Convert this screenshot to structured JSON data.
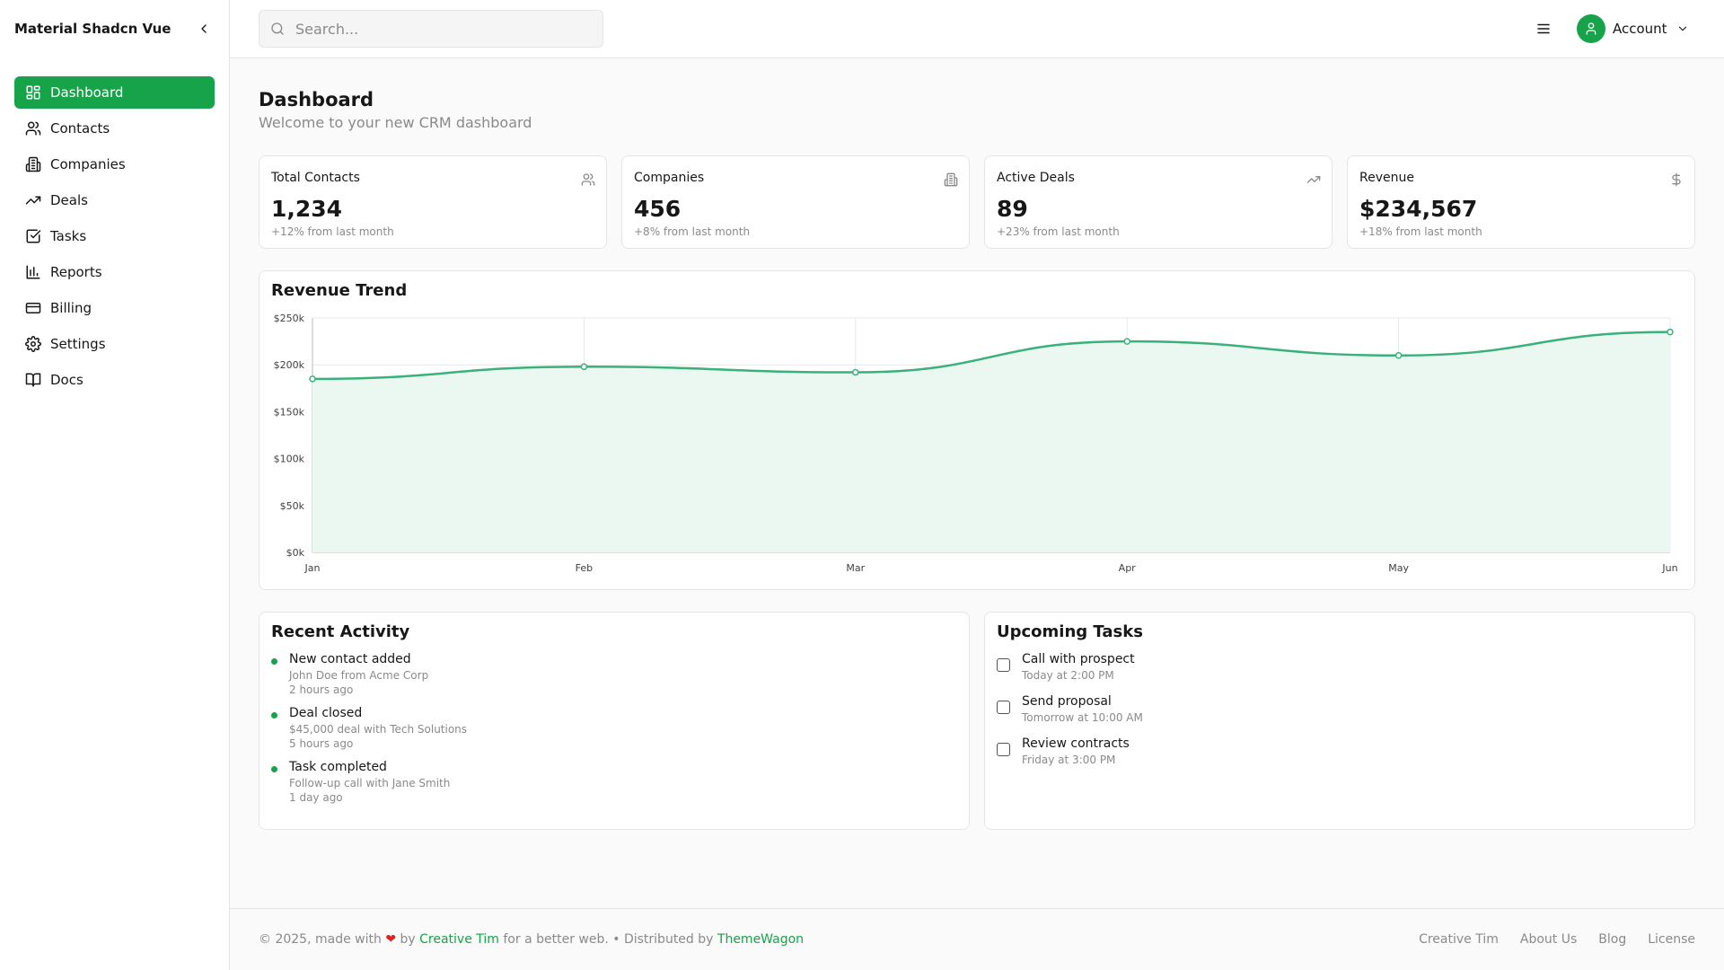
{
  "brand": {
    "name": "Material Shadcn Vue"
  },
  "sidebar": {
    "items": [
      {
        "label": "Dashboard",
        "icon": "dashboard-icon",
        "active": true
      },
      {
        "label": "Contacts",
        "icon": "users-icon"
      },
      {
        "label": "Companies",
        "icon": "building-icon"
      },
      {
        "label": "Deals",
        "icon": "trending-up-icon"
      },
      {
        "label": "Tasks",
        "icon": "check-square-icon"
      },
      {
        "label": "Reports",
        "icon": "bar-chart-icon"
      },
      {
        "label": "Billing",
        "icon": "credit-card-icon"
      },
      {
        "label": "Settings",
        "icon": "gear-icon"
      },
      {
        "label": "Docs",
        "icon": "book-icon"
      }
    ]
  },
  "header": {
    "search_placeholder": "Search...",
    "account_label": "Account"
  },
  "page": {
    "title": "Dashboard",
    "subtitle": "Welcome to your new CRM dashboard"
  },
  "stats": [
    {
      "label": "Total Contacts",
      "value": "1,234",
      "change": "+12% from last month",
      "icon": "users-icon"
    },
    {
      "label": "Companies",
      "value": "456",
      "change": "+8% from last month",
      "icon": "building-icon"
    },
    {
      "label": "Active Deals",
      "value": "89",
      "change": "+23% from last month",
      "icon": "trending-up-icon"
    },
    {
      "label": "Revenue",
      "value": "$234,567",
      "change": "+18% from last month",
      "icon": "dollar-icon"
    }
  ],
  "chart_title": "Revenue Trend",
  "chart_data": {
    "type": "area",
    "title": "Revenue Trend",
    "categories": [
      "Jan",
      "Feb",
      "Mar",
      "Apr",
      "May",
      "Jun"
    ],
    "values": [
      185000,
      198000,
      192000,
      225000,
      210000,
      235000
    ],
    "ylim": [
      0,
      250000
    ],
    "y_ticks": [
      "$0k",
      "$50k",
      "$100k",
      "$150k",
      "$200k",
      "$250k"
    ],
    "grid": true,
    "color": "#3ab07a",
    "fill": "#ebf8f1"
  },
  "activity": {
    "title": "Recent Activity",
    "items": [
      {
        "title": "New contact added",
        "desc": "John Doe from Acme Corp",
        "time": "2 hours ago"
      },
      {
        "title": "Deal closed",
        "desc": "$45,000 deal with Tech Solutions",
        "time": "5 hours ago"
      },
      {
        "title": "Task completed",
        "desc": "Follow-up call with Jane Smith",
        "time": "1 day ago"
      }
    ]
  },
  "tasks": {
    "title": "Upcoming Tasks",
    "items": [
      {
        "title": "Call with prospect",
        "time": "Today at 2:00 PM"
      },
      {
        "title": "Send proposal",
        "time": "Tomorrow at 10:00 AM"
      },
      {
        "title": "Review contracts",
        "time": "Friday at 3:00 PM"
      }
    ]
  },
  "footer": {
    "prefix": "© 2025, made with",
    "by": "by",
    "author": "Creative Tim",
    "middle": "for a better web. • Distributed by",
    "distributor": "ThemeWagon",
    "links": [
      "Creative Tim",
      "About Us",
      "Blog",
      "License"
    ]
  },
  "colors": {
    "accent": "#16a34a",
    "chart_line": "#3ab07a",
    "chart_fill": "#ebf8f1"
  }
}
